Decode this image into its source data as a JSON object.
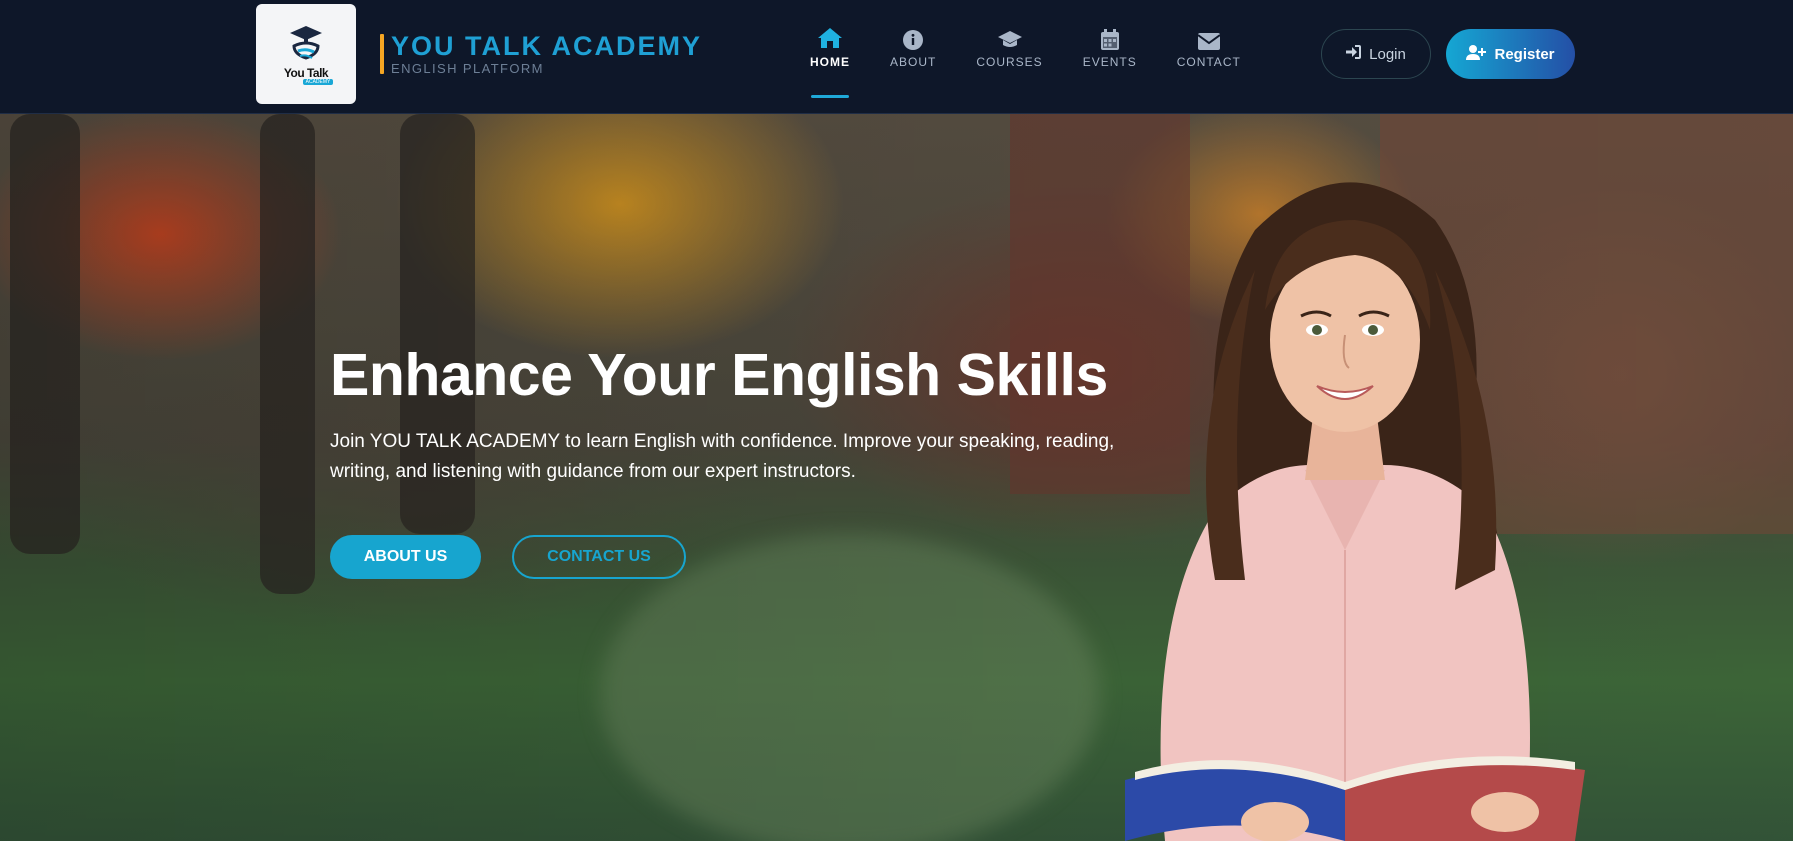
{
  "brand": {
    "logo_text": "You Talk",
    "logo_tag": "ACADEMY",
    "title": "YOU TALK ACADEMY",
    "subtitle": "ENGLISH PLATFORM"
  },
  "nav": {
    "items": [
      {
        "label": "HOME",
        "icon": "home-icon",
        "active": true
      },
      {
        "label": "ABOUT",
        "icon": "info-icon",
        "active": false
      },
      {
        "label": "COURSES",
        "icon": "graduation-cap-icon",
        "active": false
      },
      {
        "label": "EVENTS",
        "icon": "calendar-icon",
        "active": false
      },
      {
        "label": "CONTACT",
        "icon": "envelope-icon",
        "active": false
      }
    ]
  },
  "auth": {
    "login_label": "Login",
    "register_label": "Register"
  },
  "hero": {
    "title": "Enhance Your English Skills",
    "description": "Join YOU TALK ACADEMY to learn English with confidence. Improve your speaking, reading, writing, and listening with guidance from our expert instructors.",
    "about_button": "ABOUT US",
    "contact_button": "CONTACT US"
  },
  "colors": {
    "navbar_bg": "#0e1729",
    "accent": "#17a5cf",
    "brand_bar": "#f5a623",
    "register_gradient_end": "#244fa6"
  }
}
